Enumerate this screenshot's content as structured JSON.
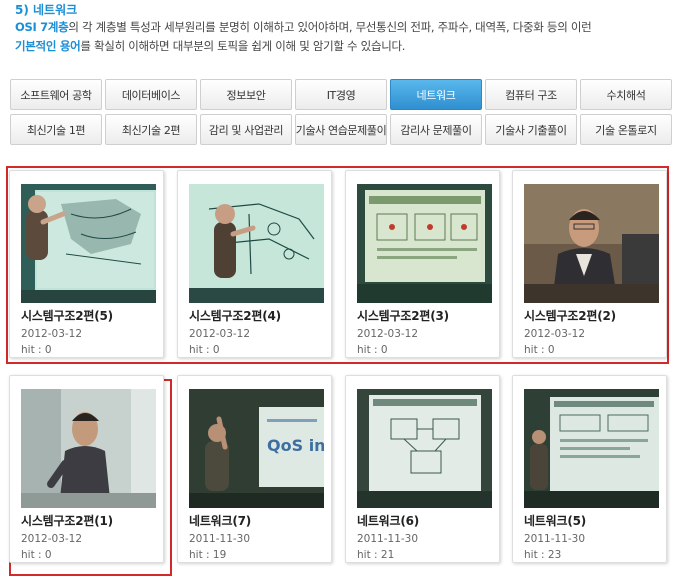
{
  "intro": {
    "title": "5) 네트워크",
    "line1_hl": "OSI 7계층",
    "line1_rest": "의 각 계층별 특성과 세부원리를 분명히 이해하고 있어야하며, 무선통신의 전파, 주파수, 대역폭, 다중화 등의 이런",
    "line2_hl": "기본적인 용어",
    "line2_rest": "를 확실히 이해하면 대부분의 토픽을 쉽게 이해 및 암기할 수 있습니다."
  },
  "tabs_row1": [
    "소프트웨어 공학",
    "데이터베이스",
    "정보보안",
    "IT경영",
    "네트워크",
    "컴퓨터 구조",
    "수치해석"
  ],
  "tabs_row2": [
    "최신기술 1편",
    "최신기술 2편",
    "감리 및 사업관리",
    "기술사 연습문제풀이",
    "감리사 문제풀이",
    "기술사 기출풀이",
    "기술 온톨로지"
  ],
  "active_tab": "네트워크",
  "videos": [
    {
      "title": "시스템구조2편(5)",
      "date": "2012-03-12",
      "hit": "hit : 0"
    },
    {
      "title": "시스템구조2편(4)",
      "date": "2012-03-12",
      "hit": "hit : 0"
    },
    {
      "title": "시스템구조2편(3)",
      "date": "2012-03-12",
      "hit": "hit : 0"
    },
    {
      "title": "시스템구조2편(2)",
      "date": "2012-03-12",
      "hit": "hit : 0"
    },
    {
      "title": "시스템구조2편(1)",
      "date": "2012-03-12",
      "hit": "hit : 0"
    },
    {
      "title": "네트워크(7)",
      "date": "2011-11-30",
      "hit": "hit : 19"
    },
    {
      "title": "네트워크(6)",
      "date": "2011-11-30",
      "hit": "hit : 21"
    },
    {
      "title": "네트워크(5)",
      "date": "2011-11-30",
      "hit": "hit : 23"
    }
  ],
  "colors": {
    "accent": "#1a8fd6",
    "active_tab": "#3a9ad8",
    "highlight_border": "#d22a2a"
  }
}
